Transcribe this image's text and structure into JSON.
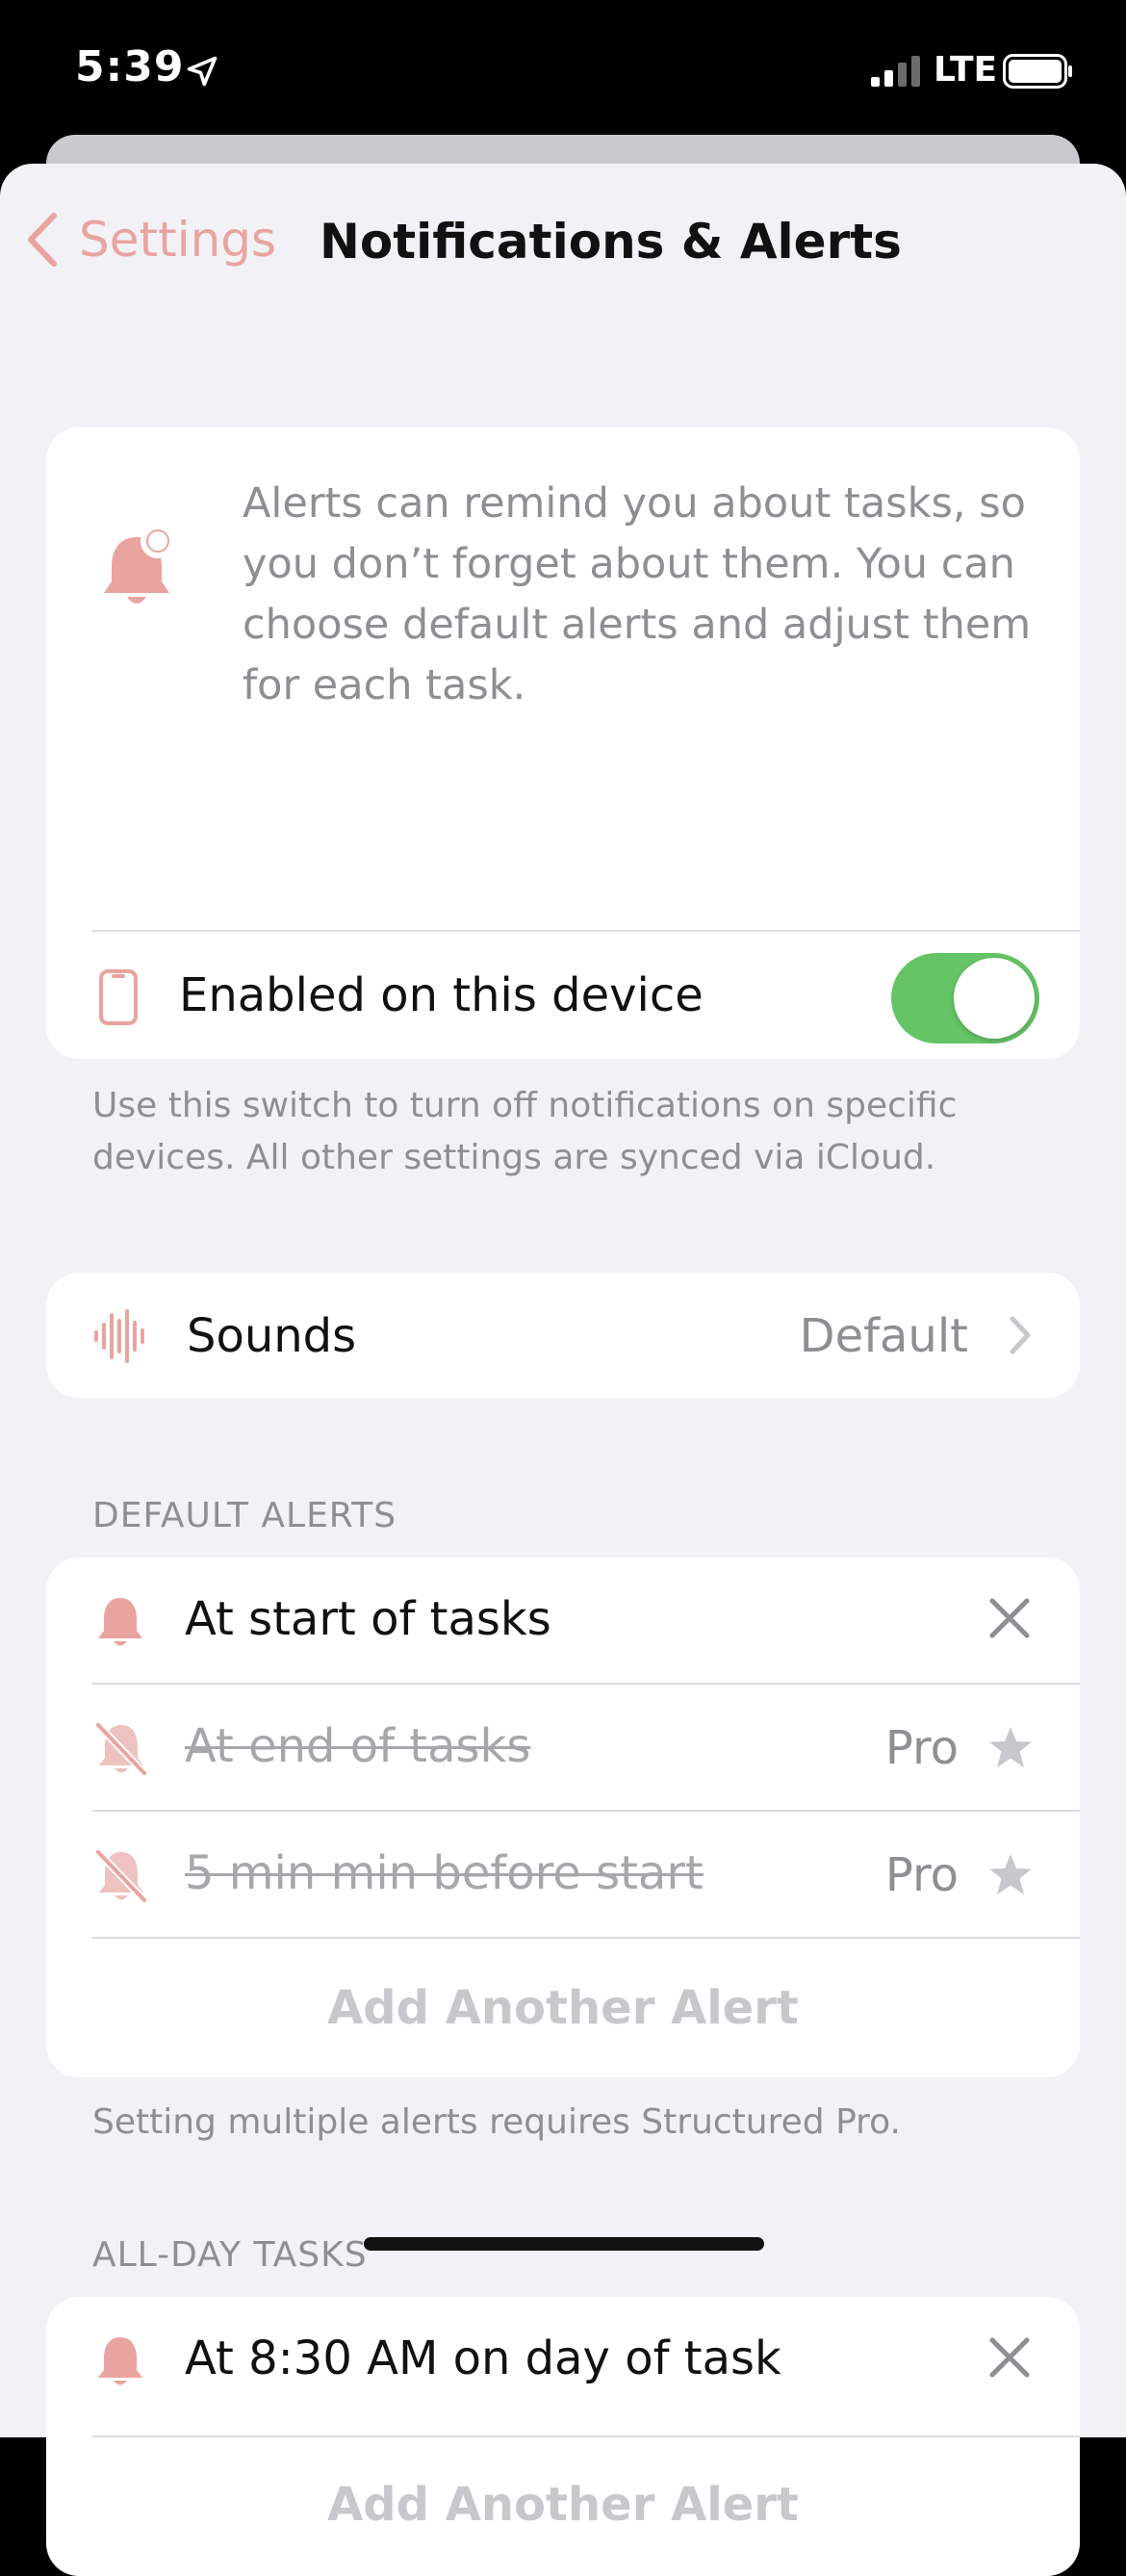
{
  "status_bar": {
    "time": "5:39",
    "network": "LTE"
  },
  "nav": {
    "back_label": "Settings",
    "title": "Notifications & Alerts"
  },
  "info": {
    "description": "Alerts can remind you about tasks, so you don’t forget about them. You can choose default alerts and adjust them for each task.",
    "device_toggle_label": "Enabled on this device",
    "device_toggle_on": true,
    "device_footnote": "Use this switch to turn off notifications on specific devices. All other settings are synced via iCloud."
  },
  "sounds": {
    "label": "Sounds",
    "value": "Default"
  },
  "default_alerts": {
    "header": "DEFAULT ALERTS",
    "items": [
      {
        "label": "At start of tasks",
        "enabled": true
      },
      {
        "label": "At end of tasks",
        "enabled": false,
        "badge": "Pro"
      },
      {
        "label": "5 min min before start",
        "enabled": false,
        "badge": "Pro"
      }
    ],
    "add_label": "Add Another Alert",
    "footnote": "Setting multiple alerts requires Structured Pro."
  },
  "all_day_tasks": {
    "header": "ALL-DAY TASKS",
    "items": [
      {
        "label": "At 8:30 AM on day of task",
        "enabled": true
      }
    ],
    "add_label": "Add Another Alert"
  },
  "colors": {
    "accent": "#e9a49f",
    "toggle_on": "#65c466",
    "secondary_text": "#8e8e93",
    "background": "#f2f1f6"
  },
  "icons": {
    "back": "chevron-left-icon",
    "info": "bell-badge-icon",
    "device": "iphone-icon",
    "sounds": "waveform-icon",
    "alert_on": "bell-icon",
    "alert_off": "bell-slash-icon",
    "remove": "xmark-icon",
    "pro": "star-icon",
    "disclosure": "chevron-right-icon"
  }
}
